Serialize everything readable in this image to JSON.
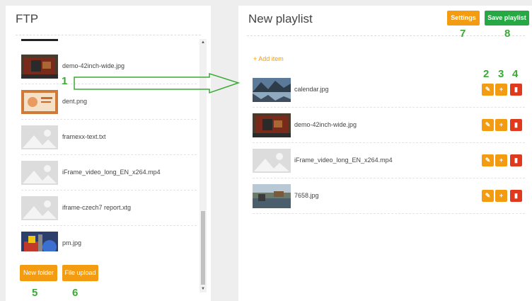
{
  "ftp": {
    "title": "FTP",
    "files": [
      {
        "name": "demo-42inch-wide.jpg",
        "thumb": "tv-image"
      },
      {
        "name": "dent.png",
        "thumb": "orange-image"
      },
      {
        "name": "framexx-text.txt",
        "thumb": "placeholder-image"
      },
      {
        "name": "iFrame_video_long_EN_x264.mp4",
        "thumb": "placeholder-image"
      },
      {
        "name": "iframe-czech7 report.xtg",
        "thumb": "placeholder-image"
      },
      {
        "name": "pm.jpg",
        "thumb": "photo-image"
      }
    ],
    "new_folder_label": "New folder",
    "file_upload_label": "File upload"
  },
  "playlist": {
    "title": "New playlist",
    "settings_label": "Settings",
    "save_label": "Save playlist",
    "add_item_label": "+ Add item",
    "items": [
      {
        "name": "calendar.jpg",
        "thumb": "lake-image"
      },
      {
        "name": "demo-42inch-wide.jpg",
        "thumb": "tv-image"
      },
      {
        "name": "iFrame_video_long_EN_x264.mp4",
        "thumb": "placeholder-image"
      },
      {
        "name": "7658.jpg",
        "thumb": "harbor-image"
      }
    ],
    "actions": {
      "edit_icon": "pencil-icon",
      "add_icon": "plus-icon",
      "delete_icon": "trash-icon"
    }
  },
  "annotations": [
    "1",
    "2",
    "3",
    "4",
    "5",
    "6",
    "7",
    "8"
  ],
  "colors": {
    "orange": "#f39c12",
    "green": "#27a844",
    "red": "#e03a1e",
    "annotation": "#3aaa35"
  }
}
